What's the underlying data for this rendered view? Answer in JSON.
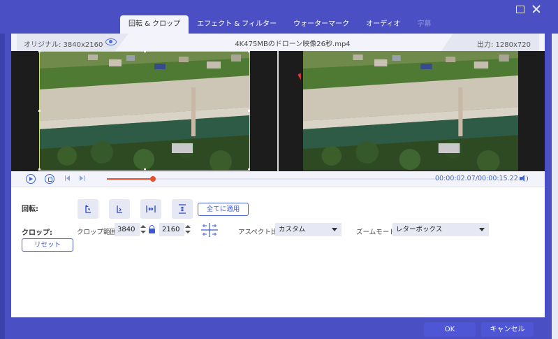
{
  "tabs": [
    {
      "label": "回転 & クロップ",
      "active": true
    },
    {
      "label": "エフェクト & フィルター",
      "active": false
    },
    {
      "label": "ウォーターマーク",
      "active": false
    },
    {
      "label": "オーディオ",
      "active": false
    },
    {
      "label": "字幕",
      "active": false,
      "disabled": true
    }
  ],
  "info": {
    "original": "オリジナル: 3840x2160",
    "file_name": "4K475MBのドローン映像26秒.mp4",
    "output": "出力: 1280x720"
  },
  "player": {
    "current_time": "00:00:02.07",
    "total_time": "/00:00:15.22",
    "progress": 0.14
  },
  "rotation": {
    "label": "回転:",
    "apply_all": "全てに適用",
    "buttons": [
      "rotate-left",
      "rotate-right",
      "flip-horizontal",
      "flip-vertical"
    ]
  },
  "crop": {
    "label": "クロップ:",
    "range_label": "クロップ範囲:",
    "width": "3840",
    "height": "2160",
    "aspect_label": "アスペクト比:",
    "aspect_value": "カスタム",
    "zoom_label": "ズームモード:",
    "zoom_value": "レターボックス",
    "reset": "リセット"
  },
  "footer": {
    "ok": "OK",
    "cancel": "キャンセル"
  },
  "colors": {
    "accent": "#4e56d6",
    "chrome": "#4a4fc4",
    "progress": "#e8502f",
    "crop_border": "#c7e27a"
  }
}
